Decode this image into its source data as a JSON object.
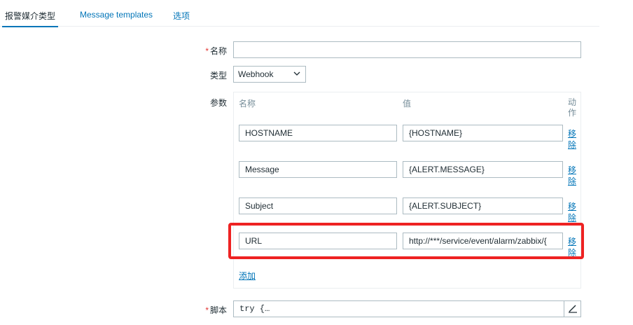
{
  "tabs": [
    {
      "label": "报警媒介类型",
      "active": true
    },
    {
      "label": "Message templates",
      "active": false
    },
    {
      "label": "选项",
      "active": false
    }
  ],
  "form": {
    "required_mark": "*",
    "name": {
      "label": "名称",
      "value": ""
    },
    "type": {
      "label": "类型",
      "selected": "Webhook"
    },
    "parameters": {
      "label": "参数",
      "headers": {
        "name": "名称",
        "value": "值",
        "action": "动作"
      },
      "rows": [
        {
          "name": "HOSTNAME",
          "value": "{HOSTNAME}",
          "remove": "移除"
        },
        {
          "name": "Message",
          "value": "{ALERT.MESSAGE}",
          "remove": "移除"
        },
        {
          "name": "Subject",
          "value": "{ALERT.SUBJECT}",
          "remove": "移除"
        },
        {
          "name": "URL",
          "value": "http://***/service/event/alarm/zabbix/{",
          "remove": "移除"
        }
      ],
      "add_label": "添加"
    },
    "script": {
      "label": "脚本",
      "value": "try {…"
    }
  },
  "colors": {
    "link": "#0275b8",
    "highlight": "#ee2222",
    "required": "#e33734"
  },
  "icons": {
    "type_dropdown": "chevron-down-icon",
    "script_edit": "pencil-icon"
  }
}
